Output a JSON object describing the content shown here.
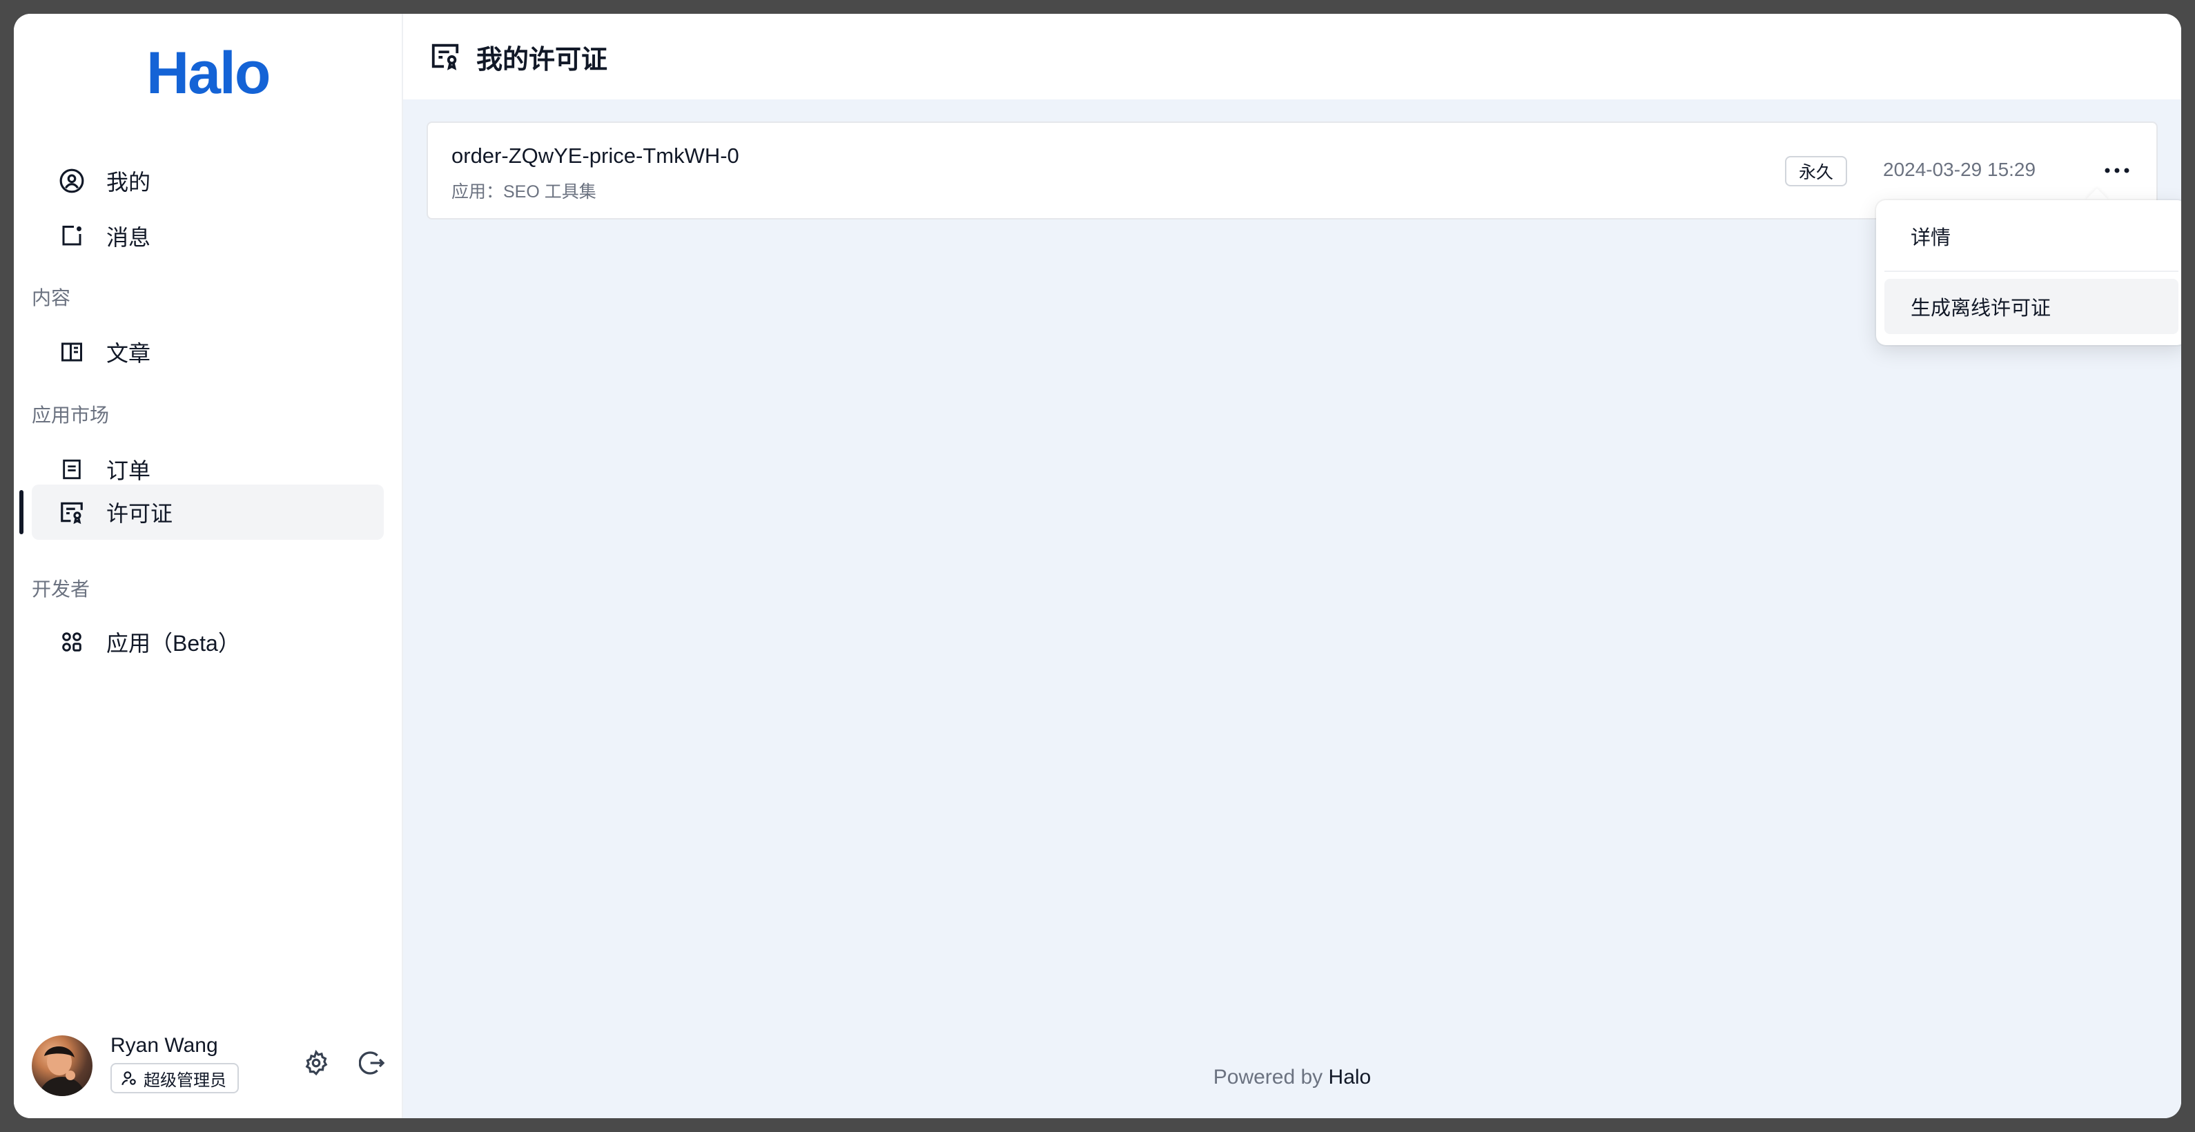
{
  "brand": {
    "logo_text": "Halo",
    "color": "#1463d6"
  },
  "sidebar": {
    "items": [
      {
        "label": "我的",
        "icon": "user-circle-icon"
      },
      {
        "label": "消息",
        "icon": "notification-icon"
      },
      {
        "label": "文章",
        "icon": "book-icon"
      },
      {
        "label": "订单",
        "icon": "order-icon"
      },
      {
        "label": "许可证",
        "icon": "license-icon",
        "active": true
      },
      {
        "label": "应用（Beta）",
        "icon": "apps-icon"
      }
    ],
    "groups": {
      "content": "内容",
      "market": "应用市场",
      "developer": "开发者"
    }
  },
  "user": {
    "name": "Ryan Wang",
    "role": "超级管理员"
  },
  "header": {
    "title": "我的许可证"
  },
  "license_card": {
    "title": "order-ZQwYE-price-TmkWH-0",
    "app_line": "应用：SEO 工具集",
    "tag": "永久",
    "time": "2024-03-29 15:29"
  },
  "dropdown": {
    "items": [
      {
        "label": "详情"
      },
      {
        "label": "生成离线许可证"
      }
    ]
  },
  "footer": {
    "prefix": "Powered by",
    "brand": "Halo"
  }
}
